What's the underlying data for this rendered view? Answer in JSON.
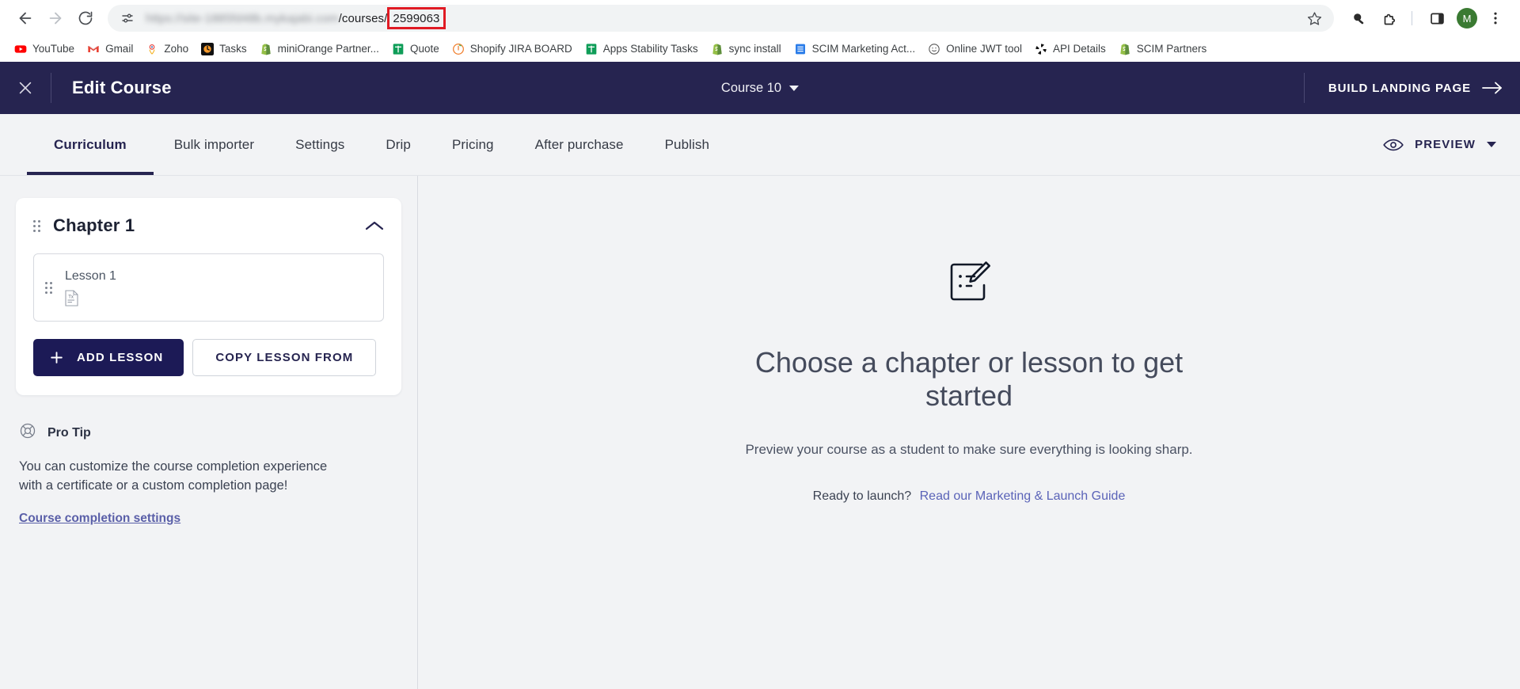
{
  "browser": {
    "back_icon": "back-arrow-icon",
    "forward_icon": "forward-arrow-icon",
    "reload_icon": "reload-icon",
    "omnibox": {
      "site_settings_icon": "site-settings-icon",
      "url_hidden": "https://site-1885fd48b.mykajabi.com",
      "url_path": "/courses/",
      "url_id": "2599063",
      "highlight_color": "#e01b24",
      "bookmark_icon": "star-icon"
    },
    "toolbar_icons": [
      {
        "name": "extension-puzzle-dark-icon"
      },
      {
        "name": "extensions-icon"
      },
      {
        "name": "side-panel-icon"
      }
    ],
    "profile_initial": "M",
    "profile_color": "#3a7a32",
    "menu_icon": "three-dot-menu-icon"
  },
  "bookmarks": [
    {
      "label": "YouTube",
      "icon": "youtube-icon"
    },
    {
      "label": "Gmail",
      "icon": "gmail-icon"
    },
    {
      "label": "Zoho",
      "icon": "zoho-icon"
    },
    {
      "label": "Tasks",
      "icon": "tasks-icon"
    },
    {
      "label": "miniOrange Partner...",
      "icon": "shopify-icon"
    },
    {
      "label": "Quote",
      "icon": "sheets-icon"
    },
    {
      "label": "Shopify JIRA BOARD",
      "icon": "jira-icon"
    },
    {
      "label": "Apps Stability Tasks",
      "icon": "sheets-icon"
    },
    {
      "label": "sync install",
      "icon": "shopify-icon"
    },
    {
      "label": "SCIM Marketing Act...",
      "icon": "docs-icon"
    },
    {
      "label": "Online JWT tool",
      "icon": "jwt-icon"
    },
    {
      "label": "API Details",
      "icon": "api-icon"
    },
    {
      "label": "SCIM Partners",
      "icon": "shopify-icon"
    }
  ],
  "app_header": {
    "close_icon": "close-icon",
    "title": "Edit Course",
    "course_selector": "Course 10",
    "build_landing_page": "BUILD LANDING PAGE",
    "arrow_icon": "arrow-right-icon",
    "bg_color": "#262450"
  },
  "tabs": [
    {
      "label": "Curriculum",
      "active": true
    },
    {
      "label": "Bulk importer",
      "active": false
    },
    {
      "label": "Settings",
      "active": false
    },
    {
      "label": "Drip",
      "active": false
    },
    {
      "label": "Pricing",
      "active": false
    },
    {
      "label": "After purchase",
      "active": false
    },
    {
      "label": "Publish",
      "active": false
    }
  ],
  "preview": {
    "eye_icon": "eye-icon",
    "label": "PREVIEW",
    "caret_icon": "caret-down-icon"
  },
  "sidebar": {
    "chapter": {
      "drag_handle_icon": "drag-handle-icon",
      "title": "Chapter 1",
      "collapse_icon": "chevron-up-icon",
      "lesson": {
        "drag_handle_icon": "drag-handle-icon",
        "name": "Lesson 1",
        "type_icon": "text-document-icon"
      },
      "add_lesson_label": "ADD LESSON",
      "add_lesson_icon": "plus-icon",
      "copy_lesson_label": "COPY LESSON FROM"
    },
    "pro_tip": {
      "icon": "lifebuoy-icon",
      "title": "Pro Tip",
      "body": "You can customize the course completion experience with a certificate or a custom completion page!",
      "link": "Course completion settings"
    }
  },
  "main": {
    "icon": "edit-checklist-icon",
    "title": "Choose a chapter or lesson to get started",
    "subtitle": "Preview your course as a student to make sure everything is looking sharp.",
    "cta_prefix": "Ready to launch?",
    "cta_link": "Read our Marketing & Launch Guide"
  }
}
